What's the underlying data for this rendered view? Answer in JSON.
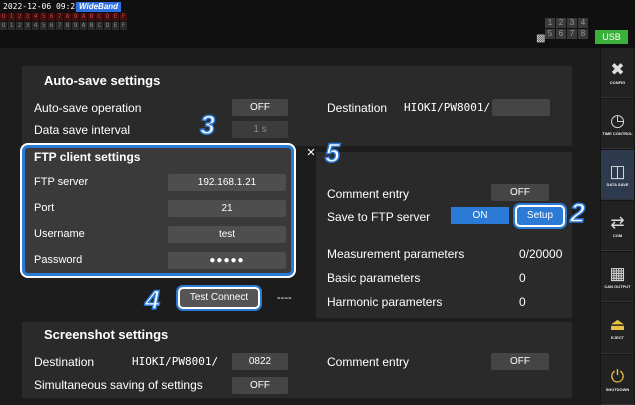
{
  "topbar": {
    "datetime": "2022-12-06 09:28:48",
    "wideband": "WideBand",
    "channels_top": [
      "U",
      "1",
      "2",
      "3",
      "4",
      "5",
      "6",
      "7",
      "8",
      "9",
      "A",
      "B",
      "C",
      "D",
      "E",
      "F"
    ],
    "channels_bottom": [
      "U",
      "1",
      "2",
      "3",
      "4",
      "5",
      "6",
      "7",
      "8",
      "9",
      "A",
      "B",
      "C",
      "D",
      "E",
      "F"
    ],
    "ch_grid": [
      "1",
      "2",
      "3",
      "4",
      "5",
      "6",
      "7",
      "8"
    ],
    "usb_label": "USB"
  },
  "sidebar": {
    "items": [
      {
        "label": "CONFIG",
        "icon": "wrench-screwdriver-icon"
      },
      {
        "label": "TIME CONTROL",
        "icon": "stopwatch-icon"
      },
      {
        "label": "DATA SAVE",
        "icon": "data-save-icon"
      },
      {
        "label": "COM",
        "icon": "com-arrows-icon"
      },
      {
        "label": "CAN OUTPUT",
        "icon": "can-output-icon"
      },
      {
        "label": "EJECT",
        "icon": "eject-icon"
      },
      {
        "label": "SHUTDOWN",
        "icon": "shutdown-icon"
      }
    ]
  },
  "autosave": {
    "title": "Auto-save settings",
    "operation_label": "Auto-save operation",
    "operation_value": "OFF",
    "interval_label": "Data save interval",
    "interval_value": "1 s",
    "destination_label": "Destination",
    "destination_value": "HIOKI/PW8001/"
  },
  "ftp": {
    "title": "FTP client settings",
    "server_label": "FTP server",
    "server_value": "192.168.1.21",
    "port_label": "Port",
    "port_value": "21",
    "username_label": "Username",
    "username_value": "test",
    "password_label": "Password",
    "password_value": "●●●●●",
    "test_button": "Test Connect",
    "test_status": "----",
    "close": "×"
  },
  "right": {
    "comment_label": "Comment entry",
    "comment_value": "OFF",
    "save_ftp_label": "Save to FTP server",
    "save_ftp_value": "ON",
    "setup_button": "Setup",
    "meas_label": "Measurement parameters",
    "meas_value": "0/20000",
    "basic_label": "Basic parameters",
    "basic_value": "0",
    "harmonic_label": "Harmonic parameters",
    "harmonic_value": "0"
  },
  "screenshot": {
    "title": "Screenshot settings",
    "destination_label": "Destination",
    "destination_path": "HIOKI/PW8001/",
    "destination_value": "0822",
    "comment_label": "Comment entry",
    "comment_value": "OFF",
    "simultaneous_label": "Simultaneous saving of settings",
    "simultaneous_value": "OFF"
  },
  "callouts": {
    "c2": "2",
    "c3": "3",
    "c4": "4",
    "c5": "5"
  },
  "colors": {
    "accent": "#2b7bd6",
    "usb": "#3ab03a",
    "sidebar_gold": "#e9c245"
  }
}
